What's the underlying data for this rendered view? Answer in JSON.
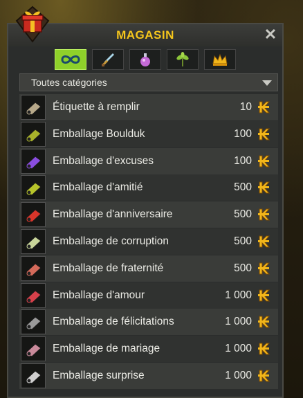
{
  "window": {
    "title": "MAGASIN",
    "close_label": "✕"
  },
  "category_tabs": [
    {
      "icon": "infinity-icon",
      "active": true
    },
    {
      "icon": "sword-icon",
      "active": false
    },
    {
      "icon": "potion-icon",
      "active": false
    },
    {
      "icon": "plant-icon",
      "active": false
    },
    {
      "icon": "crown-icon",
      "active": false
    }
  ],
  "filter": {
    "selected": "Toutes catégories"
  },
  "items": [
    {
      "name": "Étiquette à remplir",
      "price": "10",
      "icon_color": "#b7a98a"
    },
    {
      "name": "Emballage Boulduk",
      "price": "100",
      "icon_color": "#a8b22a"
    },
    {
      "name": "Emballage d'excuses",
      "price": "100",
      "icon_color": "#8a4de0"
    },
    {
      "name": "Emballage d'amitié",
      "price": "500",
      "icon_color": "#b7c42a"
    },
    {
      "name": "Emballage d'anniversaire",
      "price": "500",
      "icon_color": "#d8352a"
    },
    {
      "name": "Emballage de corruption",
      "price": "500",
      "icon_color": "#c9d69a"
    },
    {
      "name": "Emballage de fraternité",
      "price": "500",
      "icon_color": "#d46a5a"
    },
    {
      "name": "Emballage d'amour",
      "price": "1 000",
      "icon_color": "#d6404a"
    },
    {
      "name": "Emballage de félicitations",
      "price": "1 000",
      "icon_color": "#9a9a9a"
    },
    {
      "name": "Emballage de mariage",
      "price": "1 000",
      "icon_color": "#c98a9a"
    },
    {
      "name": "Emballage surprise",
      "price": "1 000",
      "icon_color": "#cfcfcf"
    }
  ],
  "colors": {
    "title": "#f5c61c",
    "active_tab": "#8fd12a",
    "currency": "#f2b61a"
  }
}
